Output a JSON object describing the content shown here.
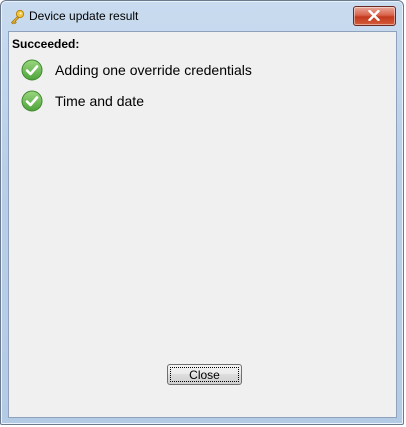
{
  "window": {
    "title": "Device update result",
    "icon": "key-icon",
    "close_icon": "close-x-icon"
  },
  "content": {
    "heading": "Succeeded:",
    "items": [
      {
        "label": "Adding one override credentials",
        "icon": "check-circle-icon",
        "status": "succeeded"
      },
      {
        "label": "Time and date",
        "icon": "check-circle-icon",
        "status": "succeeded"
      }
    ]
  },
  "footer": {
    "close_label": "Close"
  },
  "colors": {
    "success_green": "#5cb85c",
    "close_red": "#c23a1f",
    "titlebar_blue": "#c9dbef"
  }
}
